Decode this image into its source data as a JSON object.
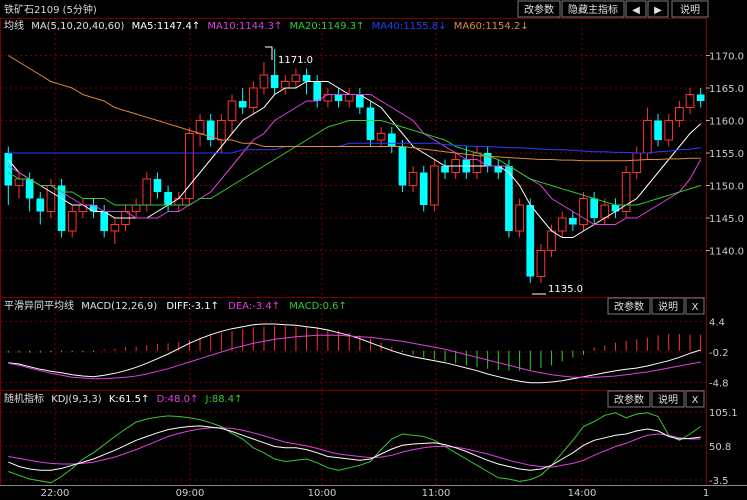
{
  "header": {
    "symbol": "铁矿石2109 (5分钟)",
    "buttons": [
      "改参数",
      "隐藏主指标",
      "◀",
      "▶",
      "说明"
    ]
  },
  "main": {
    "ma_title": "均线",
    "ma_params": "MA(5,10,20,40,60)",
    "ma_legend": [
      {
        "text": "MA5:1147.4↑",
        "color": "#ffffff"
      },
      {
        "text": "MA10:1144.3↑",
        "color": "#e040e0"
      },
      {
        "text": "MA20:1149.3↑",
        "color": "#33cc33"
      },
      {
        "text": "MA40:1155.8↓",
        "color": "#2a3cff"
      },
      {
        "text": "MA60:1154.2↓",
        "color": "#e08a3a"
      }
    ],
    "high_label": "1171.0",
    "low_label": "1135.0",
    "y_ticks": [
      "1170.0",
      "1165.0",
      "1160.0",
      "1155.0",
      "1150.0",
      "1145.0",
      "1140.0"
    ]
  },
  "macd": {
    "title": "平滑异同平均线",
    "params": "MACD(12,26,9)",
    "diff": "DIFF:-3.1↑",
    "dea": "DEA:-3.4↑",
    "macd": "MACD:0.6↑",
    "buttons": [
      "改参数",
      "说明",
      "X"
    ],
    "y_ticks": [
      "4.4",
      "-0.2",
      "-4.8"
    ]
  },
  "kdj": {
    "title": "随机指标",
    "params": "KDJ(9,3,3)",
    "k": "K:61.5↑",
    "d": "D:48.0↑",
    "j": "J:88.4↑",
    "buttons": [
      "改参数",
      "说明",
      "X"
    ],
    "y_ticks": [
      "105.1",
      "50.8",
      "-3.5"
    ]
  },
  "x_axis": [
    "22:00",
    "09:00",
    "10:00",
    "11:00",
    "14:00",
    "1"
  ],
  "colors": {
    "up": "#ff3232",
    "down": "#00ffff",
    "grid": "#7a0000"
  },
  "chart_data": {
    "type": "candlestick",
    "price_ylim": [
      1133,
      1173
    ],
    "candles": [
      [
        1155,
        1150,
        1156,
        1147
      ],
      [
        1150,
        1151,
        1152,
        1148
      ],
      [
        1151,
        1148,
        1152,
        1146
      ],
      [
        1148,
        1146,
        1149,
        1144
      ],
      [
        1146,
        1150,
        1151,
        1145
      ],
      [
        1150,
        1143,
        1151,
        1142
      ],
      [
        1143,
        1146,
        1147,
        1142
      ],
      [
        1146,
        1147,
        1148,
        1145
      ],
      [
        1147,
        1146,
        1148,
        1145
      ],
      [
        1146,
        1143,
        1147,
        1142
      ],
      [
        1143,
        1144,
        1145,
        1141
      ],
      [
        1144,
        1146,
        1147,
        1143
      ],
      [
        1146,
        1147,
        1148,
        1145
      ],
      [
        1147,
        1151,
        1152,
        1146
      ],
      [
        1151,
        1149,
        1152,
        1148
      ],
      [
        1149,
        1147,
        1150,
        1146
      ],
      [
        1147,
        1148,
        1149,
        1146
      ],
      [
        1148,
        1158,
        1159,
        1147
      ],
      [
        1158,
        1160,
        1161,
        1156
      ],
      [
        1160,
        1157,
        1161,
        1156
      ],
      [
        1157,
        1160,
        1161,
        1155
      ],
      [
        1160,
        1163,
        1164,
        1158
      ],
      [
        1163,
        1162,
        1165,
        1161
      ],
      [
        1162,
        1165,
        1166,
        1161
      ],
      [
        1165,
        1167,
        1169,
        1164
      ],
      [
        1167,
        1165,
        1171,
        1164
      ],
      [
        1165,
        1166,
        1167,
        1164
      ],
      [
        1166,
        1167,
        1168,
        1165
      ],
      [
        1167,
        1166,
        1168,
        1164
      ],
      [
        1166,
        1163,
        1167,
        1162
      ],
      [
        1163,
        1164,
        1165,
        1162
      ],
      [
        1164,
        1163,
        1165,
        1162
      ],
      [
        1163,
        1164,
        1165,
        1162
      ],
      [
        1164,
        1162,
        1165,
        1161
      ],
      [
        1162,
        1157,
        1163,
        1156
      ],
      [
        1157,
        1158,
        1159,
        1156
      ],
      [
        1158,
        1156,
        1159,
        1155
      ],
      [
        1156,
        1150,
        1157,
        1149
      ],
      [
        1150,
        1152,
        1153,
        1149
      ],
      [
        1152,
        1147,
        1153,
        1146
      ],
      [
        1147,
        1153,
        1154,
        1146
      ],
      [
        1153,
        1152,
        1154,
        1151
      ],
      [
        1152,
        1154,
        1155,
        1151
      ],
      [
        1154,
        1152,
        1156,
        1151
      ],
      [
        1152,
        1155,
        1156,
        1151
      ],
      [
        1155,
        1153,
        1156,
        1152
      ],
      [
        1153,
        1152,
        1154,
        1151
      ],
      [
        1153,
        1143,
        1154,
        1142
      ],
      [
        1143,
        1147,
        1148,
        1142
      ],
      [
        1147,
        1136,
        1148,
        1135
      ],
      [
        1136,
        1140,
        1141,
        1135
      ],
      [
        1140,
        1143,
        1144,
        1139
      ],
      [
        1143,
        1145,
        1146,
        1142
      ],
      [
        1145,
        1144,
        1146,
        1143
      ],
      [
        1144,
        1148,
        1149,
        1143
      ],
      [
        1148,
        1145,
        1149,
        1144
      ],
      [
        1145,
        1147,
        1148,
        1144
      ],
      [
        1147,
        1146,
        1148,
        1145
      ],
      [
        1146,
        1152,
        1153,
        1145
      ],
      [
        1152,
        1155,
        1156,
        1151
      ],
      [
        1155,
        1160,
        1162,
        1154
      ],
      [
        1160,
        1157,
        1161,
        1156
      ],
      [
        1157,
        1160,
        1161,
        1156
      ],
      [
        1160,
        1162,
        1163,
        1159
      ],
      [
        1162,
        1164,
        1165,
        1161
      ],
      [
        1164,
        1163,
        1165,
        1162
      ]
    ],
    "ma": {
      "MA5": [
        1154,
        1152,
        1151,
        1150,
        1149,
        1148,
        1147,
        1147,
        1146,
        1146,
        1145,
        1145,
        1145,
        1145,
        1146,
        1147,
        1148,
        1150,
        1152,
        1154,
        1156,
        1158,
        1160,
        1161,
        1162,
        1164,
        1165,
        1165,
        1166,
        1166,
        1166,
        1165,
        1164,
        1164,
        1163,
        1162,
        1160,
        1158,
        1156,
        1155,
        1154,
        1153,
        1153,
        1153,
        1153,
        1153,
        1153,
        1152,
        1150,
        1147,
        1145,
        1143,
        1142,
        1142,
        1143,
        1144,
        1145,
        1146,
        1147,
        1148,
        1150,
        1152,
        1154,
        1156,
        1158,
        1159.5
      ],
      "MA10": [
        1153,
        1152,
        1151,
        1150,
        1150,
        1149,
        1148,
        1147,
        1147,
        1146,
        1146,
        1146,
        1145,
        1145,
        1145,
        1146,
        1146,
        1147,
        1148,
        1149,
        1151,
        1153,
        1155,
        1157,
        1158,
        1160,
        1161,
        1162,
        1163,
        1163,
        1164,
        1164,
        1164,
        1164,
        1164,
        1163,
        1162,
        1161,
        1160,
        1158,
        1157,
        1156,
        1155,
        1154,
        1154,
        1153,
        1153,
        1153,
        1152,
        1151,
        1150,
        1148,
        1147,
        1146,
        1145,
        1144,
        1144,
        1144,
        1145,
        1145,
        1146,
        1147,
        1148,
        1149,
        1151,
        1154
      ],
      "MA20": [
        1152,
        1151,
        1151,
        1150,
        1150,
        1149,
        1149,
        1148,
        1148,
        1148,
        1147,
        1147,
        1147,
        1147,
        1147,
        1147,
        1147,
        1147,
        1148,
        1148,
        1149,
        1150,
        1151,
        1152,
        1153,
        1154,
        1155,
        1156,
        1157,
        1158,
        1159,
        1159.5,
        1160,
        1160,
        1160,
        1160,
        1159.5,
        1159,
        1158.5,
        1158,
        1157.5,
        1157,
        1156,
        1155.5,
        1155,
        1154.5,
        1154,
        1153,
        1152,
        1151,
        1150.5,
        1150,
        1149.5,
        1149,
        1148.5,
        1148,
        1147.5,
        1147,
        1147,
        1147,
        1147.5,
        1148,
        1148.5,
        1149,
        1149.5,
        1150
      ],
      "MA40": [
        1155,
        1155,
        1155,
        1155,
        1155,
        1155,
        1155,
        1155,
        1155,
        1155,
        1155,
        1155,
        1155,
        1155,
        1155,
        1155,
        1155,
        1155,
        1155,
        1155,
        1155,
        1155,
        1155.5,
        1155.5,
        1155.5,
        1155.5,
        1156,
        1156,
        1156,
        1156,
        1156,
        1156,
        1156.5,
        1156.5,
        1156.5,
        1156.5,
        1156.5,
        1156.5,
        1156.5,
        1156.5,
        1156.5,
        1156.3,
        1156.2,
        1156.1,
        1156,
        1156,
        1155.9,
        1155.8,
        1155.8,
        1155.7,
        1155.6,
        1155.5,
        1155.5,
        1155.4,
        1155.3,
        1155.2,
        1155.2,
        1155.1,
        1155.1,
        1155,
        1155,
        1155.2,
        1155.3,
        1155.5,
        1155.6,
        1155.8
      ],
      "MA60": [
        1170,
        1169,
        1168,
        1167,
        1166,
        1165.5,
        1165,
        1164,
        1163.5,
        1163,
        1162,
        1161.5,
        1161,
        1160.5,
        1160,
        1159.5,
        1159,
        1158.5,
        1158,
        1157.5,
        1157,
        1157,
        1156.5,
        1156.5,
        1156,
        1156,
        1156,
        1156,
        1156,
        1156,
        1156,
        1156,
        1156,
        1156,
        1156,
        1156,
        1156,
        1156,
        1155.8,
        1155.6,
        1155.4,
        1155.2,
        1155,
        1154.8,
        1154.6,
        1154.5,
        1154.4,
        1154.3,
        1154.2,
        1154.1,
        1154,
        1154,
        1153.9,
        1153.9,
        1153.8,
        1153.8,
        1153.8,
        1153.8,
        1153.8,
        1153.9,
        1154,
        1154,
        1154.1,
        1154.1,
        1154.2,
        1154.2
      ]
    },
    "macd_ylim": [
      -5.6,
      5.2
    ],
    "macd": {
      "hist": [
        -0.3,
        -0.3,
        -0.3,
        -0.3,
        -0.2,
        -0.2,
        -0.2,
        -0.2,
        -0.2,
        0.2,
        0.3,
        0.5,
        0.6,
        0.8,
        1.0,
        1.1,
        1.3,
        1.6,
        2.0,
        2.4,
        2.7,
        2.9,
        3.2,
        3.5,
        3.6,
        3.7,
        3.7,
        3.6,
        3.5,
        3.4,
        3.2,
        3.0,
        2.7,
        2.3,
        1.8,
        1.2,
        0.6,
        -0.2,
        -0.6,
        -1.0,
        -1.3,
        -1.6,
        -1.9,
        -2.2,
        -2.5,
        -2.7,
        -2.9,
        -3.0,
        -3.0,
        -2.9,
        -2.6,
        -2.2,
        -1.6,
        -1.0,
        -0.6,
        0.5,
        0.8,
        1.2,
        1.5,
        1.7,
        1.9,
        2.3,
        2.5,
        2.5,
        2.4,
        2.4
      ],
      "diff": [
        -1.8,
        -2.0,
        -2.4,
        -2.8,
        -3.1,
        -3.3,
        -3.6,
        -3.8,
        -3.9,
        -3.7,
        -3.4,
        -3.0,
        -2.5,
        -1.9,
        -1.2,
        -0.5,
        0.3,
        1.1,
        1.8,
        2.4,
        2.9,
        3.3,
        3.6,
        3.9,
        4.0,
        4.0,
        3.9,
        3.8,
        3.6,
        3.4,
        3.1,
        2.7,
        2.3,
        1.8,
        1.2,
        0.6,
        0.0,
        -0.5,
        -0.9,
        -1.2,
        -1.5,
        -1.8,
        -2.2,
        -2.6,
        -3.0,
        -3.5,
        -3.9,
        -4.3,
        -4.6,
        -4.8,
        -4.8,
        -4.7,
        -4.5,
        -4.2,
        -3.9,
        -3.6,
        -3.3,
        -3.0,
        -2.8,
        -2.6,
        -2.3,
        -1.9,
        -1.5,
        -1.0,
        -0.4,
        0.1
      ],
      "dea": [
        -1.9,
        -2.2,
        -2.6,
        -3.0,
        -3.4,
        -3.7,
        -4.0,
        -4.1,
        -4.2,
        -4.2,
        -4.1,
        -4.0,
        -3.8,
        -3.5,
        -3.1,
        -2.7,
        -2.2,
        -1.7,
        -1.2,
        -0.7,
        -0.2,
        0.3,
        0.7,
        1.1,
        1.4,
        1.7,
        1.9,
        2.1,
        2.2,
        2.3,
        2.3,
        2.3,
        2.2,
        2.1,
        2.0,
        1.8,
        1.6,
        1.4,
        1.1,
        0.8,
        0.5,
        0.2,
        -0.2,
        -0.6,
        -1.0,
        -1.4,
        -1.8,
        -2.2,
        -2.6,
        -3.0,
        -3.3,
        -3.6,
        -3.8,
        -4.0,
        -4.0,
        -4.0,
        -3.9,
        -3.8,
        -3.6,
        -3.4,
        -3.2,
        -2.9,
        -2.6,
        -2.3,
        -2.0,
        -1.7
      ]
    },
    "kdj_ylim": [
      -10,
      110
    ],
    "kdj": {
      "K": [
        25,
        18,
        14,
        12,
        12,
        15,
        20,
        25,
        30,
        37,
        44,
        52,
        60,
        66,
        72,
        77,
        80,
        82,
        83,
        81,
        79,
        74,
        68,
        62,
        56,
        50,
        48,
        48,
        45,
        40,
        34,
        32,
        30,
        28,
        30,
        38,
        46,
        52,
        54,
        55,
        56,
        53,
        48,
        42,
        35,
        28,
        22,
        18,
        14,
        12,
        14,
        20,
        30,
        40,
        52,
        60,
        64,
        68,
        70,
        75,
        78,
        75,
        66,
        62,
        63,
        65
      ],
      "D": [
        34,
        31,
        28,
        25,
        23,
        22,
        22,
        23,
        25,
        29,
        33,
        39,
        45,
        52,
        59,
        66,
        71,
        75,
        78,
        80,
        80,
        79,
        76,
        72,
        67,
        62,
        57,
        54,
        51,
        47,
        42,
        38,
        36,
        34,
        32,
        33,
        36,
        41,
        45,
        48,
        50,
        50,
        49,
        46,
        42,
        38,
        33,
        28,
        24,
        20,
        18,
        17,
        20,
        23,
        28,
        36,
        43,
        50,
        55,
        62,
        68,
        70,
        68,
        64,
        62,
        62
      ],
      "J": [
        10,
        4,
        -2,
        -5,
        -8,
        2,
        15,
        30,
        40,
        53,
        66,
        78,
        89,
        94,
        97,
        99,
        98,
        96,
        93,
        88,
        82,
        71,
        62,
        48,
        40,
        30,
        26,
        28,
        30,
        24,
        16,
        12,
        16,
        20,
        26,
        45,
        62,
        70,
        68,
        66,
        60,
        50,
        40,
        30,
        20,
        10,
        0,
        -2,
        -6,
        -3,
        4,
        20,
        40,
        60,
        82,
        90,
        100,
        104,
        96,
        102,
        104,
        98,
        68,
        60,
        70,
        82
      ]
    }
  }
}
